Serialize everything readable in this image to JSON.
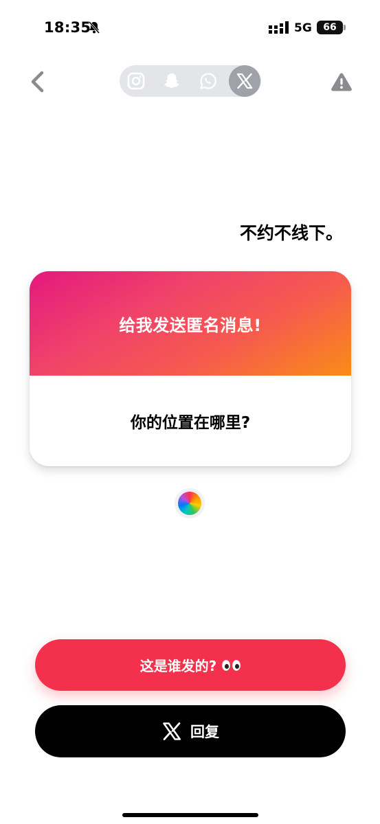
{
  "status_bar": {
    "time": "18:35",
    "network": "5G",
    "battery": "66"
  },
  "platforms": [
    {
      "name": "instagram",
      "icon": "instagram-icon"
    },
    {
      "name": "snapchat",
      "icon": "snapchat-icon"
    },
    {
      "name": "whatsapp",
      "icon": "whatsapp-icon"
    },
    {
      "name": "x",
      "icon": "x-icon",
      "active": true
    }
  ],
  "message": {
    "text": "不约不线下。"
  },
  "card": {
    "header_text": "给我发送匿名消息!",
    "question": "你的位置在哪里?"
  },
  "buttons": {
    "who_sent_label": "这是谁发的?",
    "reply_label": "回复"
  },
  "colors": {
    "accent": "#f4314c",
    "gradient_start": "#e4187e",
    "gradient_end": "#f98c17"
  }
}
